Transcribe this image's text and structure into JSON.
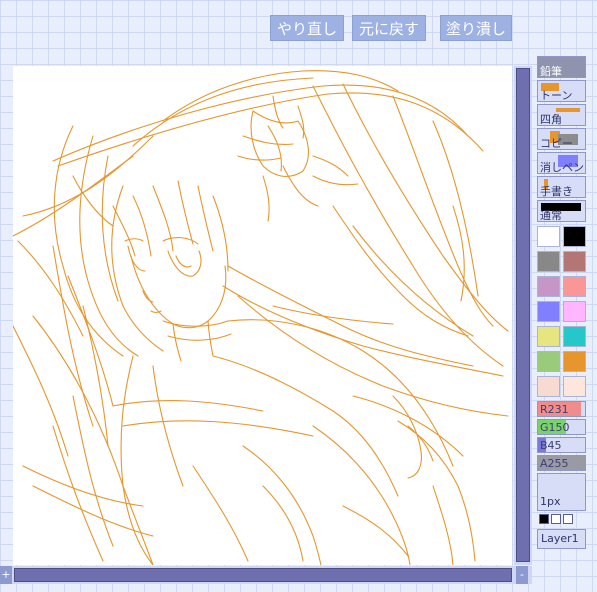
{
  "toolbar": {
    "redo": "やり直し",
    "undo": "元に戻す",
    "fill": "塗り潰し"
  },
  "tools": [
    {
      "label": "鉛筆",
      "selected": true
    },
    {
      "label": "トーン",
      "selected": false
    },
    {
      "label": "四角",
      "selected": false
    },
    {
      "label": "コピー",
      "selected": false
    },
    {
      "label": "消しペン",
      "selected": false
    },
    {
      "label": "手書き",
      "selected": false
    },
    {
      "label": "通常",
      "selected": false
    }
  ],
  "palette": [
    [
      "#ffffff",
      "#000000"
    ],
    [
      "#888888",
      "#b47575"
    ],
    [
      "#c696c6",
      "#fa9696"
    ],
    [
      "#8080ff",
      "#ffb6ff"
    ],
    [
      "#e7e580",
      "#25c7c9"
    ],
    [
      "#99cb7b",
      "#e7962d"
    ],
    [
      "#f8dbd0",
      "#fde7dc"
    ]
  ],
  "sliders": {
    "r": {
      "label": "R231",
      "value": 231,
      "color": "#f18c8c"
    },
    "g": {
      "label": "G150",
      "value": 150,
      "color": "#7ad36a"
    },
    "b": {
      "label": "B45",
      "value": 45,
      "color": "#7a7ad8"
    },
    "a": {
      "label": "A255",
      "value": 255,
      "color": "#9a9aa4"
    }
  },
  "pen_size": "1px",
  "layer": "Layer1",
  "colors": {
    "stroke": "#e7962d",
    "canvas_bg": "#ffffff",
    "button_bg": "#9db1e3",
    "scroll_thumb": "#6f6fb0"
  }
}
